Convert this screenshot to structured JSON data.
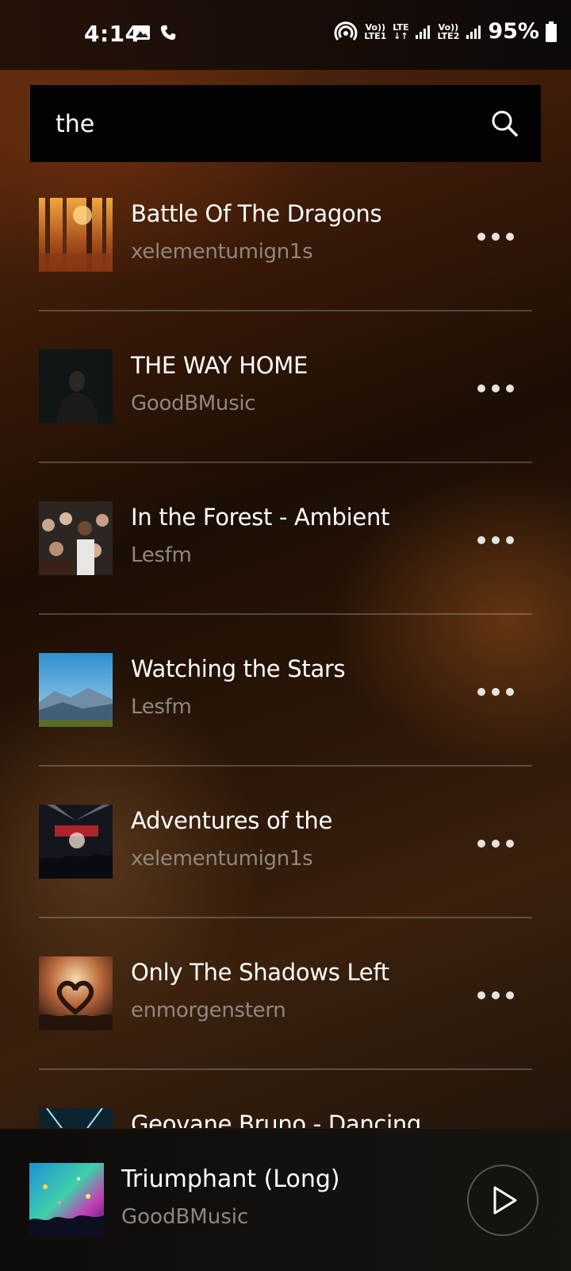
{
  "status_bar": {
    "time": "4:14",
    "icons": [
      "gallery-icon",
      "phone-icon",
      "hotspot-icon",
      "signal-icon",
      "battery-icon"
    ],
    "lte1_top": "Vo))",
    "lte1_bottom": "LTE1",
    "lte_top": "LTE",
    "lte_bottom": "↓↑",
    "lte2_top": "Vo))",
    "lte2_bottom": "LTE2",
    "battery": "95%"
  },
  "search": {
    "query": "the"
  },
  "results": [
    {
      "title": "Battle Of The Dragons",
      "artist": "xelementumign1s",
      "thumb": "forest-icon"
    },
    {
      "title": "THE WAY HOME",
      "artist": "GoodBMusic",
      "thumb": "portrait-icon"
    },
    {
      "title": "In the Forest - Ambient",
      "artist": "Lesfm",
      "thumb": "crowd-icon"
    },
    {
      "title": "Watching the Stars",
      "artist": "Lesfm",
      "thumb": "mountains-icon"
    },
    {
      "title": "Adventures of the",
      "artist": "xelementumign1s",
      "thumb": "concert-icon"
    },
    {
      "title": "Only The Shadows Left",
      "artist": "enmorgenstern",
      "thumb": "heart-hands-icon"
    },
    {
      "title": "Geovane Bruno - Dancing",
      "artist": "",
      "thumb": "stage-lights-icon"
    }
  ],
  "now_playing": {
    "title": "Triumphant (Long)",
    "artist": "GoodBMusic",
    "thumb": "festival-icon"
  },
  "colors": {
    "search_bg": "#030202",
    "secondary_text": "#8f8780",
    "accent": "#5a2c0f"
  }
}
